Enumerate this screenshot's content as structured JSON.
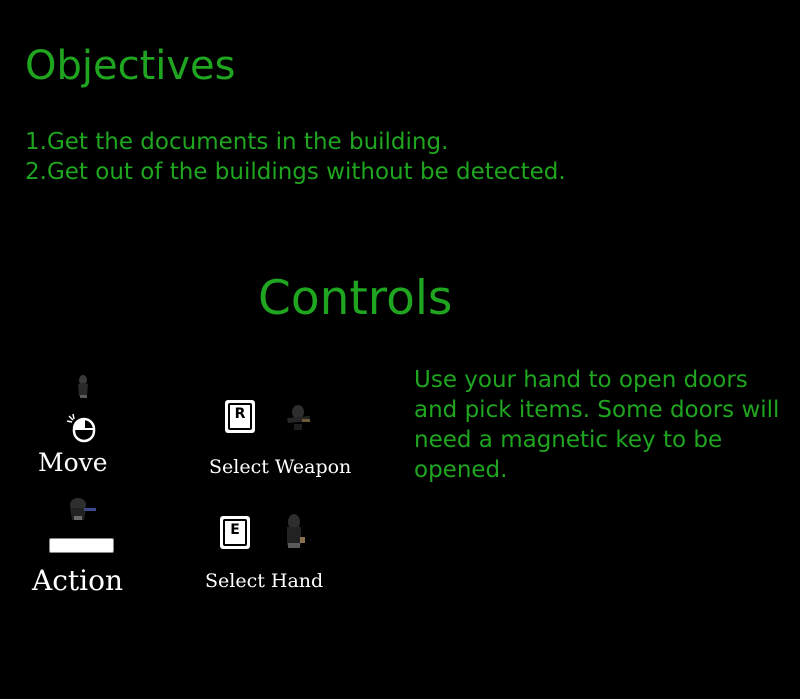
{
  "objectives": {
    "title": "Objectives",
    "items": [
      "1.Get the documents in the building.",
      "2.Get out of the buildings without be detected."
    ]
  },
  "controls": {
    "title": "Controls",
    "move_label": "Move",
    "action_label": "Action",
    "select_weapon_label": "Select Weapon",
    "select_hand_label": "Select Hand",
    "weapon_key": "R",
    "hand_key": "E",
    "hint_text": "Use your hand to open doors and pick items. Some doors will need a magnetic key to be opened."
  },
  "colors": {
    "background": "#000000",
    "accent_green": "#1fa51f",
    "label_white": "#ffffff"
  },
  "icons": [
    "character-icon",
    "mouse-icon",
    "character-action-icon",
    "spacebar-key-icon",
    "r-key-icon",
    "weapon-character-icon",
    "e-key-icon",
    "hand-character-icon"
  ]
}
